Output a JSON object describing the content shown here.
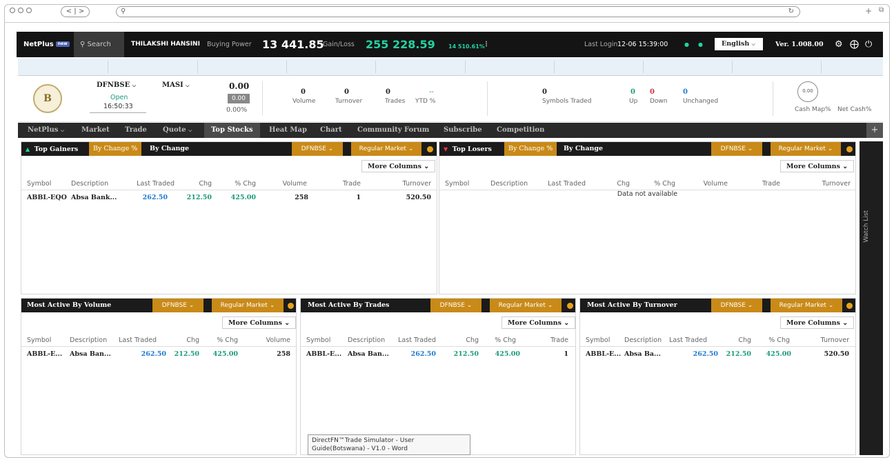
{
  "browser": {
    "back": "<",
    "fwd": ">",
    "search_icon": "search-icon",
    "reload_icon": "reload-icon"
  },
  "appbar": {
    "brand": "NetPlus",
    "brand_badge": "new",
    "search_label": "Search",
    "user": "THILAKSHI HANSINI",
    "buying_power_label": "Buying Power",
    "buying_power": "13 441.85",
    "gain_loss_label": "Gain/Loss",
    "gain_loss": "255 228.59",
    "gain_loss_pct": "14 510.61%",
    "last_login_label": "Last Login",
    "last_login": "12-06 15:39:00",
    "language": "English",
    "version": "Ver. 1.008.00"
  },
  "info": {
    "exchange": "DFNBSE",
    "status": "Open",
    "time": "16:50:33",
    "index": "MASI",
    "index_value": "0.00",
    "index_change": "0.00",
    "index_pct": "0.00%",
    "volume": "0",
    "volume_label": "Volume",
    "turnover": "0",
    "turnover_label": "Turnover",
    "trades": "0",
    "trades_label": "Trades",
    "ytd": "--",
    "ytd_label": "YTD %",
    "symbols_traded": "0",
    "symbols_traded_label": "Symbols Traded",
    "up": "0",
    "up_label": "Up",
    "down": "0",
    "down_label": "Down",
    "unchanged": "0",
    "unchanged_label": "Unchanged",
    "cash_map_value": "0.00",
    "cash_map_label": "Cash Map%",
    "net_cash_label": "Net Cash%"
  },
  "nav": {
    "items": [
      "NetPlus",
      "Market",
      "Trade",
      "Quote",
      "Top Stocks",
      "Heat Map",
      "Chart",
      "Community Forum",
      "Subscribe",
      "Competition"
    ]
  },
  "panels": {
    "gainers": {
      "title": "Top Gainers",
      "tab1": "By Change %",
      "tab2": "By Change",
      "exchange": "DFNBSE",
      "market": "Regular Market",
      "more": "More Columns",
      "cols": [
        "Symbol",
        "Description",
        "Last Traded",
        "Chg",
        "% Chg",
        "Volume",
        "Trade",
        "Turnover"
      ],
      "row": [
        "ABBL-EQO",
        "Absa Bank...",
        "262.50",
        "212.50",
        "425.00",
        "258",
        "1",
        "520.50"
      ]
    },
    "losers": {
      "title": "Top Losers",
      "tab1": "By Change %",
      "tab2": "By Change",
      "exchange": "DFNBSE",
      "market": "Regular Market",
      "more": "More Columns",
      "cols": [
        "Symbol",
        "Description",
        "Last Traded",
        "Chg",
        "% Chg",
        "Volume",
        "Trade",
        "Turnover"
      ],
      "empty": "Data not available"
    },
    "volume": {
      "title": "Most Active By Volume",
      "exchange": "DFNBSE",
      "market": "Regular Market",
      "more": "More Columns",
      "cols": [
        "Symbol",
        "Description",
        "Last Traded",
        "Chg",
        "% Chg",
        "Volume"
      ],
      "row": [
        "ABBL-E...",
        "Absa Ban...",
        "262.50",
        "212.50",
        "425.00",
        "258"
      ]
    },
    "trades": {
      "title": "Most Active By Trades",
      "exchange": "DFNBSE",
      "market": "Regular Market",
      "more": "More Columns",
      "cols": [
        "Symbol",
        "Description",
        "Last Traded",
        "Chg",
        "% Chg",
        "Trade"
      ],
      "row": [
        "ABBL-E...",
        "Absa Ban...",
        "262.50",
        "212.50",
        "425.00",
        "1"
      ]
    },
    "turnover": {
      "title": "Most Active By Turnover",
      "exchange": "DFNBSE",
      "market": "Regular Market",
      "more": "More Columns",
      "cols": [
        "Symbol",
        "Description",
        "Last Traded",
        "Chg",
        "% Chg",
        "Turnover"
      ],
      "row": [
        "ABBL-E...",
        "Absa Ba...",
        "262.50",
        "212.50",
        "425.00",
        "520.50"
      ]
    }
  },
  "watchlist": "Watch List",
  "tooltip": "DirectFN™Trade Simulator - User Guide(Botswana) - V1.0 - Word"
}
